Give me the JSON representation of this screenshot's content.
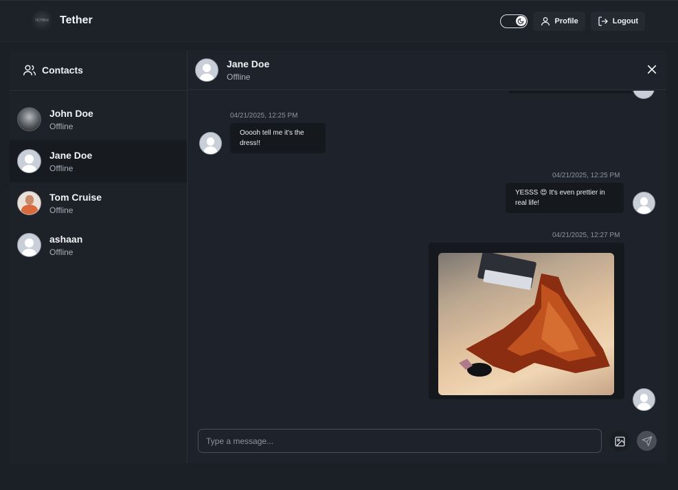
{
  "navbar": {
    "brand_name": "Tether",
    "logo_text": "TETHER",
    "profile_label": "Profile",
    "logout_label": "Logout"
  },
  "sidebar": {
    "title": "Contacts",
    "contacts": [
      {
        "name": "John Doe",
        "status": "Offline",
        "avatar": "photo"
      },
      {
        "name": "Jane Doe",
        "status": "Offline",
        "avatar": "default",
        "active": true
      },
      {
        "name": "Tom Cruise",
        "status": "Offline",
        "avatar": "photo"
      },
      {
        "name": "ashaan",
        "status": "Offline",
        "avatar": "default"
      }
    ]
  },
  "chat": {
    "contact_name": "Jane Doe",
    "contact_status": "Offline",
    "messages": [
      {
        "from": "Jane Doe",
        "time": "04/21/2025, 12:25 PM",
        "text": "Ooooh tell me it's the dress!!"
      },
      {
        "from": "me",
        "time": "04/21/2025, 12:25 PM",
        "text": "YESSS 😍 It's even prettier in real life!"
      },
      {
        "from": "me",
        "time": "04/21/2025, 12:27 PM",
        "attachment": "dress photo"
      }
    ],
    "composer_placeholder": "Type a message..."
  },
  "icons": {
    "theme_toggle": "moon-icon",
    "profile": "user-icon",
    "logout": "logout-icon",
    "contacts": "users-icon",
    "close": "close-icon",
    "image": "image-icon",
    "send": "send-icon"
  },
  "colors": {
    "background": "#1b1f26",
    "panel": "#1e232b",
    "bubble": "#15181d",
    "active_contact": "#171a1f"
  }
}
